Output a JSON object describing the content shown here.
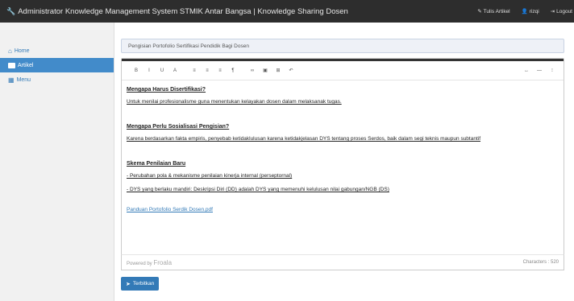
{
  "navbar": {
    "brand_icon": "wrench-icon",
    "brand": "Administrator Knowledge Management System STMIK Antar Bangsa | Knowledge Sharing Dosen",
    "items": [
      {
        "icon": "pencil-icon",
        "label": "Tulis Artikel"
      },
      {
        "icon": "user-icon",
        "label": "rizqi"
      },
      {
        "icon": "logout-icon",
        "label": "Logout"
      }
    ]
  },
  "sidebar": {
    "items": [
      {
        "icon": "home-icon",
        "label": "Home"
      },
      {
        "icon": "article-icon",
        "label": "Artikel"
      },
      {
        "icon": "grid-icon",
        "label": "Menu"
      }
    ]
  },
  "article": {
    "title_value": "Pengisian Portofolio Sertifikasi Pendidik Bagi Dosen"
  },
  "toolbar": {
    "left": [
      "B",
      "I",
      "U",
      "A",
      "≡",
      "≡",
      "≡",
      "¶",
      "∞",
      "▣",
      "⊞",
      "↶"
    ],
    "right": [
      "↔",
      "—",
      "⁝"
    ]
  },
  "content": {
    "h1": "Mengapa Harus Disertifikasi?",
    "p1": "Untuk menilai profesionalisme guna menentukan kelayakan dosen dalam melaksanak tugas.",
    "h2": "Mengapa Perlu Sosialisasi Pengisian?",
    "p2": "Karena berdasarkan fakta empiris, penyebab ketidaklulusan karena ketidakjelasan DYS tentang proses Serdos, baik dalam segi teknis maupun subtantif",
    "h3": "Skema Penilaian Baru",
    "li1": "- Perubahan pola & mekanisme penilaian kinerja internal (perseptornal)",
    "li2": "- DYS yang berlaku mandiri: Deskripsi Diri (DD) adalah DYS yang memenuhi kelulusan nilai gabungan/NGB (DS)",
    "link": "Panduan Portofolio Serdik Dosen.pdf"
  },
  "footer": {
    "powered_prefix": "Powered by",
    "powered_brand": "Froala",
    "characters": "Characters : 520"
  },
  "publish": {
    "icon": "send-icon",
    "label": "Terbitkan"
  }
}
